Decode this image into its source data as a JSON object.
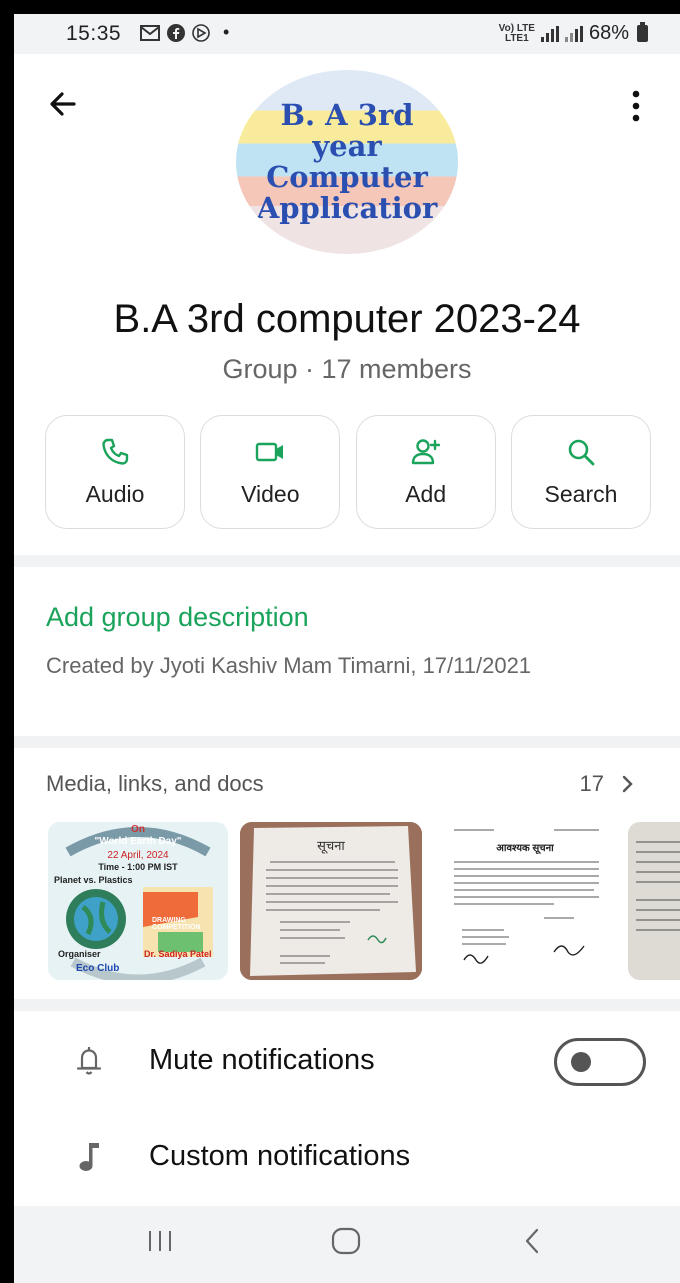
{
  "status_bar": {
    "time": "15:35",
    "notification_icons": [
      "gmail-icon",
      "facebook-icon",
      "vpn-icon"
    ],
    "dot": "•",
    "network_top": "Vo) LTE",
    "network_bottom": "LTE1",
    "battery": "68%"
  },
  "header": {
    "avatar_lines": [
      "B. A 3rd",
      "year",
      "Computer",
      "Applicatior"
    ],
    "group_name": "B.A 3rd computer 2023-24",
    "subtitle": "Group · 17 members"
  },
  "actions": [
    {
      "label": "Audio",
      "icon": "phone-icon"
    },
    {
      "label": "Video",
      "icon": "video-icon"
    },
    {
      "label": "Add",
      "icon": "add-person-icon"
    },
    {
      "label": "Search",
      "icon": "search-icon"
    }
  ],
  "description": {
    "add_link": "Add group description",
    "created_by": "Created by Jyoti Kashiv  Mam Timarni, 17/11/2021"
  },
  "media": {
    "heading": "Media, links, and docs",
    "count": "17",
    "chevron": ">",
    "poster": {
      "on": "On",
      "event": "\"World Earth Day\"",
      "date": "22 April, 2024",
      "time": "Time - 1:00 PM IST",
      "theme": "Planet vs. Plastics",
      "competition": "DRAWING COMPETITION",
      "organiser": "Organiser",
      "club": "Eco Club",
      "coordinator": "Dr. Sadiya Patel"
    },
    "notice_title": "सूचना",
    "notice2_title": "आवश्यक सूचना"
  },
  "settings": [
    {
      "label": "Mute notifications",
      "icon": "bell-icon",
      "toggle": false
    },
    {
      "label": "Custom notifications",
      "icon": "music-note-icon"
    }
  ],
  "nav_bar": {
    "recents": "recents-icon",
    "home": "home-icon",
    "back": "back-icon"
  },
  "colors": {
    "accent": "#1aa35a",
    "icon_green": "#1aa35a",
    "background": "#ffffff",
    "separator": "#f0f2f4"
  }
}
